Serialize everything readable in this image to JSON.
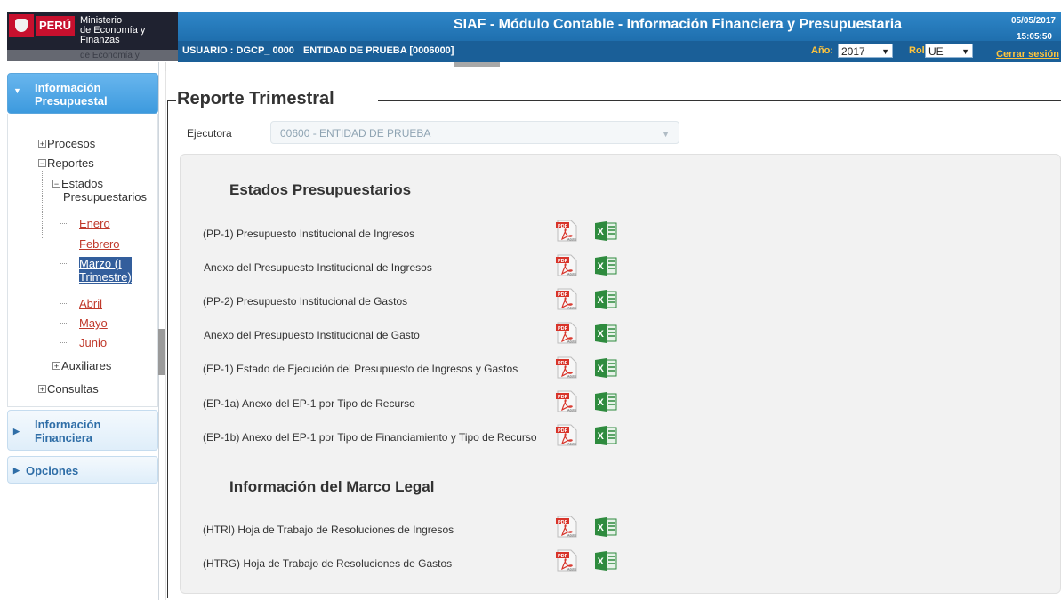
{
  "header": {
    "logo": {
      "country": "PERÚ",
      "ministry_line1": "Ministerio",
      "ministry_line2": "de Economía y Finanzas",
      "ministry_shadow": "de Economía y Finanzas"
    },
    "title": "SIAF - Módulo Contable - Información Financiera y Presupuestaria",
    "date": "05/05/2017",
    "time": "15:05:50",
    "user": "USUARIO : DGCP_ 0000",
    "entity": "ENTIDAD DE PRUEBA [0006000]",
    "year_label": "Año:",
    "year_value": "2017",
    "rol_label": "Rol:",
    "rol_value": "UE",
    "logout": "Cerrar sesión",
    "caret": "▼"
  },
  "sidebar": {
    "sections": [
      {
        "label_line1": "Información",
        "label_line2": "Presupuestal",
        "arrow": "▼"
      },
      {
        "label_line1": "Información",
        "label_line2": "Financiera",
        "arrow": "▶"
      },
      {
        "label": "Opciones",
        "arrow": "▶"
      }
    ],
    "tree": {
      "procesos": "Procesos",
      "reportes": "Reportes",
      "estados_line1": "Estados",
      "estados_line2": "Presupuestarios",
      "months": [
        "Enero",
        "Febrero",
        "Marzo (I",
        "Trimestre)",
        "Abril",
        "Mayo",
        "Junio"
      ],
      "auxiliares": "Auxiliares",
      "consultas": "Consultas",
      "plus": "+",
      "minus": "−"
    }
  },
  "main": {
    "title": "Reporte Trimestral",
    "ejecutora_label": "Ejecutora",
    "ejecutora_value": "00600 - ENTIDAD DE PRUEBA",
    "estados_title": "Estados Presupuestarios",
    "estados_rows": [
      "(PP-1) Presupuesto Institucional de Ingresos",
      "Anexo del Presupuesto Institucional de Ingresos",
      "(PP-2) Presupuesto Institucional de Gastos",
      "Anexo del Presupuesto Institucional de Gasto",
      "(EP-1) Estado de Ejecución del Presupuesto de Ingresos y Gastos",
      "(EP-1a) Anexo del EP-1 por Tipo de Recurso",
      "(EP-1b) Anexo del EP-1 por Tipo de Financiamiento y Tipo de Recurso"
    ],
    "marco_title": "Información del Marco Legal",
    "marco_rows": [
      "(HTRI) Hoja de Trabajo de Resoluciones de Ingresos",
      "(HTRG) Hoja de Trabajo de Resoluciones de Gastos"
    ],
    "icons": {
      "pdf_text": "PDF",
      "pdf_brand": "Adobe",
      "excel_text": "X"
    }
  },
  "colors": {
    "header_blue": "#2278bd",
    "header_dark": "#1a5f98",
    "accent_yellow": "#ffc43d",
    "link_red": "#c0392b",
    "selected_bg": "#335e9c",
    "pdf_red": "#d8342a",
    "excel_green": "#2e8b3e"
  }
}
